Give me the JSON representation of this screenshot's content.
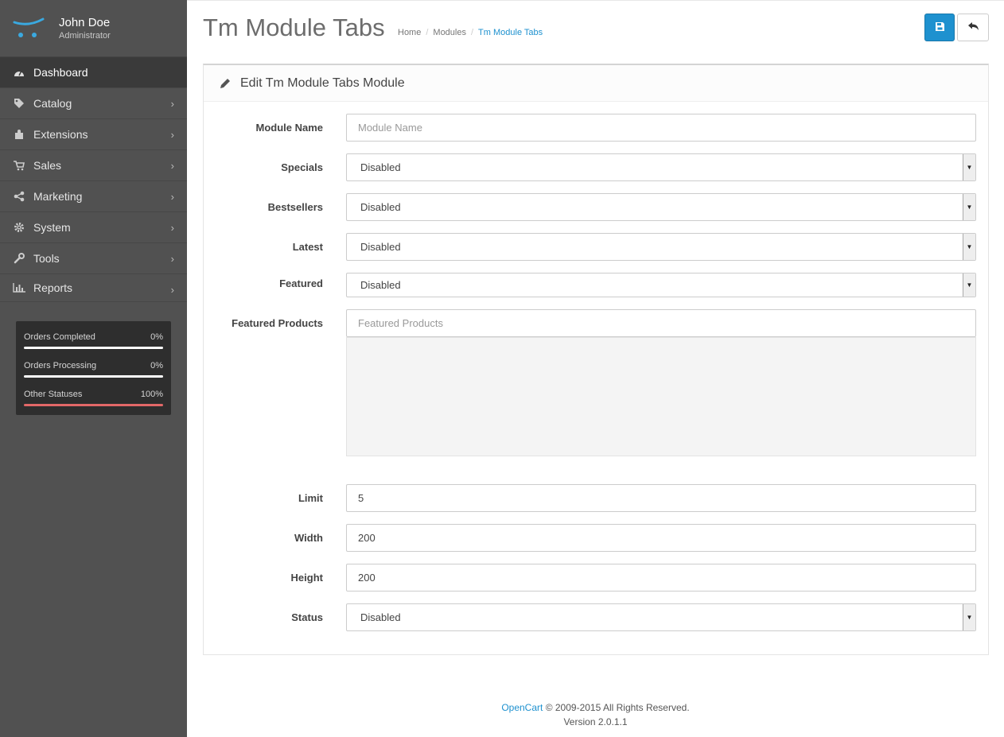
{
  "profile": {
    "name": "John Doe",
    "role": "Administrator"
  },
  "menu": [
    {
      "label": "Dashboard",
      "icon": "dashboard-icon",
      "active": true
    },
    {
      "label": "Catalog",
      "icon": "tags-icon"
    },
    {
      "label": "Extensions",
      "icon": "puzzle-icon"
    },
    {
      "label": "Sales",
      "icon": "cart-icon"
    },
    {
      "label": "Marketing",
      "icon": "share-icon"
    },
    {
      "label": "System",
      "icon": "gear-icon"
    },
    {
      "label": "Tools",
      "icon": "wrench-icon"
    },
    {
      "label": "Reports",
      "icon": "bar-chart-icon"
    }
  ],
  "stats": [
    {
      "label": "Orders Completed",
      "pct": "0%",
      "value": 0,
      "color": "#ffffff"
    },
    {
      "label": "Orders Processing",
      "pct": "0%",
      "value": 0,
      "color": "#ffffff"
    },
    {
      "label": "Other Statuses",
      "pct": "100%",
      "value": 100,
      "color": "#e36868"
    }
  ],
  "header": {
    "title": "Tm Module Tabs",
    "breadcrumb": [
      "Home",
      "Modules",
      "Tm Module Tabs"
    ]
  },
  "panel": {
    "heading": "Edit Tm Module Tabs Module"
  },
  "form": {
    "module_name": {
      "label": "Module Name",
      "placeholder": "Module Name"
    },
    "specials": {
      "label": "Specials",
      "value": "Disabled"
    },
    "bestsellers": {
      "label": "Bestsellers",
      "value": "Disabled"
    },
    "latest": {
      "label": "Latest",
      "value": "Disabled"
    },
    "featured": {
      "label": "Featured",
      "value": "Disabled"
    },
    "featured_products": {
      "label": "Featured Products",
      "placeholder": "Featured Products"
    },
    "limit": {
      "label": "Limit",
      "value": "5"
    },
    "width": {
      "label": "Width",
      "value": "200"
    },
    "height": {
      "label": "Height",
      "value": "200"
    },
    "status": {
      "label": "Status",
      "value": "Disabled"
    }
  },
  "footer": {
    "link": "OpenCart",
    "copyright": "© 2009-2015 All Rights Reserved.",
    "version": "Version 2.0.1.1"
  },
  "colors": {
    "accent": "#1e91cf",
    "sidebar": "#515151",
    "danger_bar": "#e36868"
  }
}
